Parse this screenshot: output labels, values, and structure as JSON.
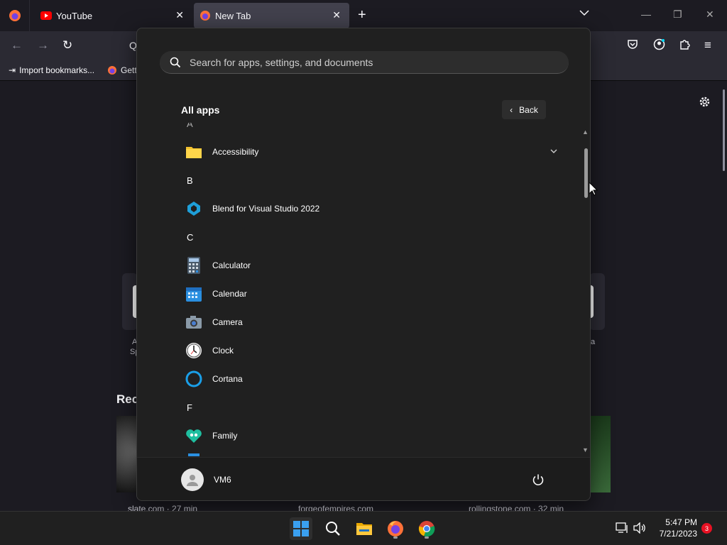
{
  "browser": {
    "tabs": [
      {
        "title": "YouTube",
        "icon": "youtube-icon"
      },
      {
        "title": "New Tab",
        "icon": "firefox-icon"
      }
    ],
    "bookmarks": [
      {
        "label": "Import bookmarks...",
        "icon": "import-icon"
      },
      {
        "label": "Gett",
        "icon": "firefox-icon"
      }
    ],
    "recent_label": "Rec",
    "tile_fragments": {
      "left_a": "A",
      "left_b": "Sp",
      "right_a": "a"
    },
    "recent_captions": [
      "slate.com · 27 min",
      "forgeofempires.com",
      "rollingstone.com · 32 min"
    ]
  },
  "start_menu": {
    "search_placeholder": "Search for apps, settings, and documents",
    "all_apps_label": "All apps",
    "back_label": "Back",
    "items": [
      {
        "kind": "letter",
        "text": "A"
      },
      {
        "kind": "app",
        "label": "Accessibility",
        "icon": "folder-icon",
        "expandable": true
      },
      {
        "kind": "letter",
        "text": "B"
      },
      {
        "kind": "app",
        "label": "Blend for Visual Studio 2022",
        "icon": "blend-icon"
      },
      {
        "kind": "letter",
        "text": "C"
      },
      {
        "kind": "app",
        "label": "Calculator",
        "icon": "calculator-icon"
      },
      {
        "kind": "app",
        "label": "Calendar",
        "icon": "calendar-icon"
      },
      {
        "kind": "app",
        "label": "Camera",
        "icon": "camera-icon"
      },
      {
        "kind": "app",
        "label": "Clock",
        "icon": "clock-icon"
      },
      {
        "kind": "app",
        "label": "Cortana",
        "icon": "cortana-icon"
      },
      {
        "kind": "letter",
        "text": "F"
      },
      {
        "kind": "app",
        "label": "Family",
        "icon": "family-icon"
      }
    ],
    "user_name": "VM6"
  },
  "taskbar": {
    "apps": [
      "start-icon",
      "search-icon",
      "file-explorer-icon",
      "firefox-icon",
      "chrome-icon"
    ],
    "time": "5:47 PM",
    "date": "7/21/2023",
    "notification_count": "3"
  },
  "colors": {
    "accent": "#0078d4",
    "start_bg": "#202020",
    "browser_bg": "#1c1b22",
    "firefox_orange": "#ff7139"
  }
}
